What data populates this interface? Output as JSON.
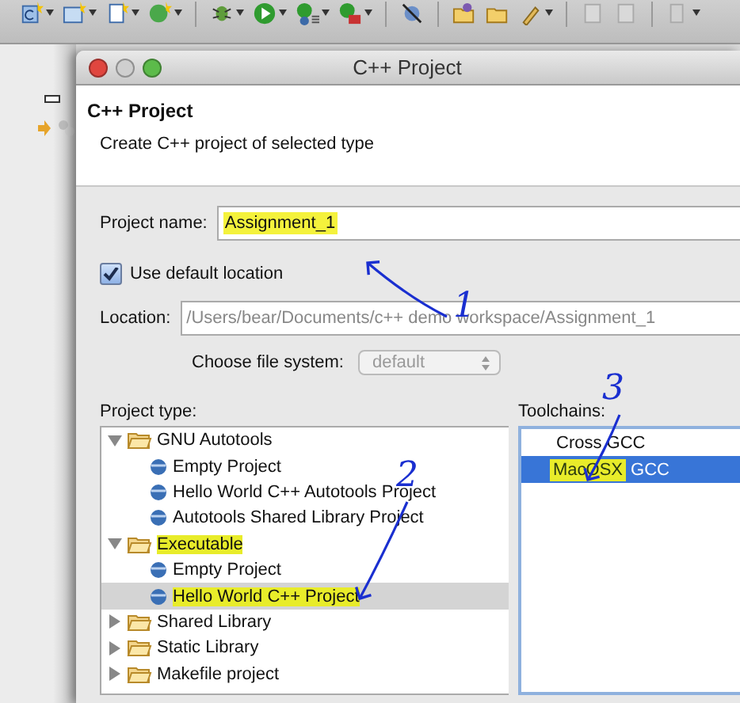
{
  "dialog": {
    "title": "C++ Project",
    "header": {
      "title": "C++ Project",
      "description": "Create C++ project of selected type"
    },
    "project_name": {
      "label": "Project name:",
      "value": "Assignment_1",
      "highlighted": true
    },
    "use_default_location": {
      "label": "Use default location",
      "checked": true
    },
    "location": {
      "label": "Location:",
      "value": "/Users/bear/Documents/c++ demo workspace/Assignment_1",
      "disabled": true
    },
    "file_system": {
      "label": "Choose file system:",
      "value": "default",
      "disabled": true
    },
    "project_type": {
      "label": "Project type:",
      "tree": [
        {
          "label": "GNU Autotools",
          "expanded": true,
          "highlighted": false,
          "selected": false,
          "children": [
            {
              "label": "Empty Project",
              "highlighted": false,
              "selected": false
            },
            {
              "label": "Hello World C++ Autotools Project",
              "highlighted": false,
              "selected": false
            },
            {
              "label": "Autotools Shared Library Project",
              "highlighted": false,
              "selected": false
            }
          ]
        },
        {
          "label": "Executable",
          "expanded": true,
          "highlighted": true,
          "selected": false,
          "children": [
            {
              "label": "Empty Project",
              "highlighted": false,
              "selected": false
            },
            {
              "label": "Hello World C++ Project",
              "highlighted": true,
              "selected": true
            }
          ]
        },
        {
          "label": "Shared Library",
          "expanded": false,
          "highlighted": false,
          "selected": false
        },
        {
          "label": "Static Library",
          "expanded": false,
          "highlighted": false,
          "selected": false
        },
        {
          "label": "Makefile project",
          "expanded": false,
          "highlighted": false,
          "selected": false
        }
      ]
    },
    "toolchains": {
      "label": "Toolchains:",
      "items": [
        {
          "selected": false,
          "parts": [
            {
              "text": "Cross GCC",
              "highlighted": false
            }
          ]
        },
        {
          "selected": true,
          "parts": [
            {
              "text": "MacOSX",
              "highlighted": true
            },
            {
              "text": "GCC",
              "highlighted": false
            }
          ]
        }
      ]
    }
  },
  "annotations": [
    {
      "number": "1"
    },
    {
      "number": "2"
    },
    {
      "number": "3"
    }
  ]
}
